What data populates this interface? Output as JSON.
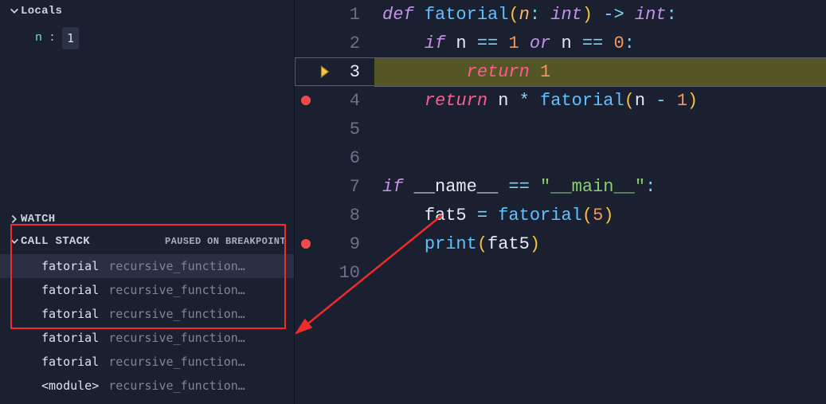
{
  "sidebar": {
    "locals": {
      "title": "Locals",
      "expanded": true,
      "vars": [
        {
          "name": "n",
          "value": "1"
        }
      ]
    },
    "watch": {
      "title": "WATCH",
      "expanded": false
    },
    "callstack": {
      "title": "CALL STACK",
      "status": "PAUSED ON BREAKPOINT",
      "expanded": true,
      "frames": [
        {
          "fn": "fatorial",
          "src": "recursive_function…",
          "selected": true
        },
        {
          "fn": "fatorial",
          "src": "recursive_function…"
        },
        {
          "fn": "fatorial",
          "src": "recursive_function…"
        },
        {
          "fn": "fatorial",
          "src": "recursive_function…"
        },
        {
          "fn": "fatorial",
          "src": "recursive_function…"
        },
        {
          "fn": "<module>",
          "src": "recursive_function…"
        }
      ]
    }
  },
  "editor": {
    "current_line": 3,
    "breakpoints": [
      4,
      9
    ],
    "lines": [
      {
        "n": 1,
        "tokens": [
          [
            "kw",
            "def "
          ],
          [
            "fn",
            "fatorial"
          ],
          [
            "br",
            "("
          ],
          [
            "prm",
            "n"
          ],
          [
            "op",
            ": "
          ],
          [
            "typ",
            "int"
          ],
          [
            "br",
            ")"
          ],
          [
            "op",
            " -> "
          ],
          [
            "typ",
            "int"
          ],
          [
            "op",
            ":"
          ]
        ]
      },
      {
        "n": 2,
        "tokens": [
          [
            "",
            "    "
          ],
          [
            "kw",
            "if "
          ],
          [
            "var",
            "n"
          ],
          [
            "op",
            " == "
          ],
          [
            "num",
            "1"
          ],
          [
            "kw",
            " or "
          ],
          [
            "var",
            "n"
          ],
          [
            "op",
            " == "
          ],
          [
            "num",
            "0"
          ],
          [
            "op",
            ":"
          ]
        ]
      },
      {
        "n": 3,
        "tokens": [
          [
            "",
            "        "
          ],
          [
            "pnk",
            "return "
          ],
          [
            "num",
            "1"
          ]
        ]
      },
      {
        "n": 4,
        "tokens": [
          [
            "",
            "    "
          ],
          [
            "pnk",
            "return "
          ],
          [
            "var",
            "n"
          ],
          [
            "op",
            " * "
          ],
          [
            "fn",
            "fatorial"
          ],
          [
            "br",
            "("
          ],
          [
            "var",
            "n"
          ],
          [
            "op",
            " - "
          ],
          [
            "num",
            "1"
          ],
          [
            "br",
            ")"
          ]
        ]
      },
      {
        "n": 5,
        "tokens": []
      },
      {
        "n": 6,
        "tokens": []
      },
      {
        "n": 7,
        "tokens": [
          [
            "kw",
            "if "
          ],
          [
            "dun",
            "__name__"
          ],
          [
            "op",
            " == "
          ],
          [
            "str",
            "\"__main__\""
          ],
          [
            "op",
            ":"
          ]
        ]
      },
      {
        "n": 8,
        "tokens": [
          [
            "",
            "    "
          ],
          [
            "var",
            "fat5"
          ],
          [
            "op",
            " = "
          ],
          [
            "fn",
            "fatorial"
          ],
          [
            "br",
            "("
          ],
          [
            "num",
            "5"
          ],
          [
            "br",
            ")"
          ]
        ]
      },
      {
        "n": 9,
        "tokens": [
          [
            "",
            "    "
          ],
          [
            "fn",
            "print"
          ],
          [
            "br",
            "("
          ],
          [
            "var",
            "fat5"
          ],
          [
            "br",
            ")"
          ]
        ]
      },
      {
        "n": 10,
        "tokens": []
      }
    ]
  },
  "annotation": {
    "box": {
      "top_frame": 0,
      "bottom_frame": 3
    }
  }
}
